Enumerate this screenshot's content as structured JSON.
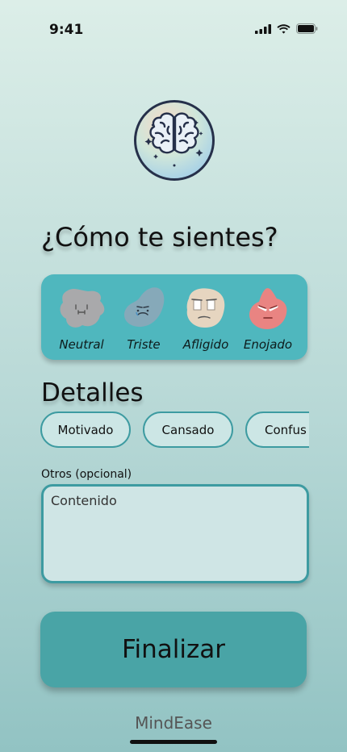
{
  "status_bar": {
    "time": "9:41",
    "icons": [
      "cellular-signal-icon",
      "wifi-icon",
      "battery-icon"
    ]
  },
  "logo": {
    "icon": "brain-icon"
  },
  "mood_section": {
    "title": "¿Cómo te sientes?",
    "moods": [
      {
        "label": "Neutral",
        "icon": "neutral-face-icon",
        "color": "#a9a9ab"
      },
      {
        "label": "Triste",
        "icon": "sad-face-icon",
        "color": "#86a9b9"
      },
      {
        "label": "Afligido",
        "icon": "distressed-face-icon",
        "color": "#e6d5c0"
      },
      {
        "label": "Enojado",
        "icon": "angry-face-icon",
        "color": "#e98482"
      }
    ]
  },
  "details_section": {
    "title": "Detalles",
    "chips": [
      "Motivado",
      "Cansado",
      "Confus"
    ]
  },
  "notes": {
    "label": "Otros (opcional)",
    "value": "Contenido"
  },
  "actions": {
    "finalize_label": "Finalizar"
  },
  "footer": {
    "brand": "MindEase"
  },
  "colors": {
    "accent": "#4fb7be",
    "button": "#49a4a6",
    "border": "#3d9ba1",
    "background_top": "#dceee8",
    "background_bottom": "#92c3c3"
  }
}
